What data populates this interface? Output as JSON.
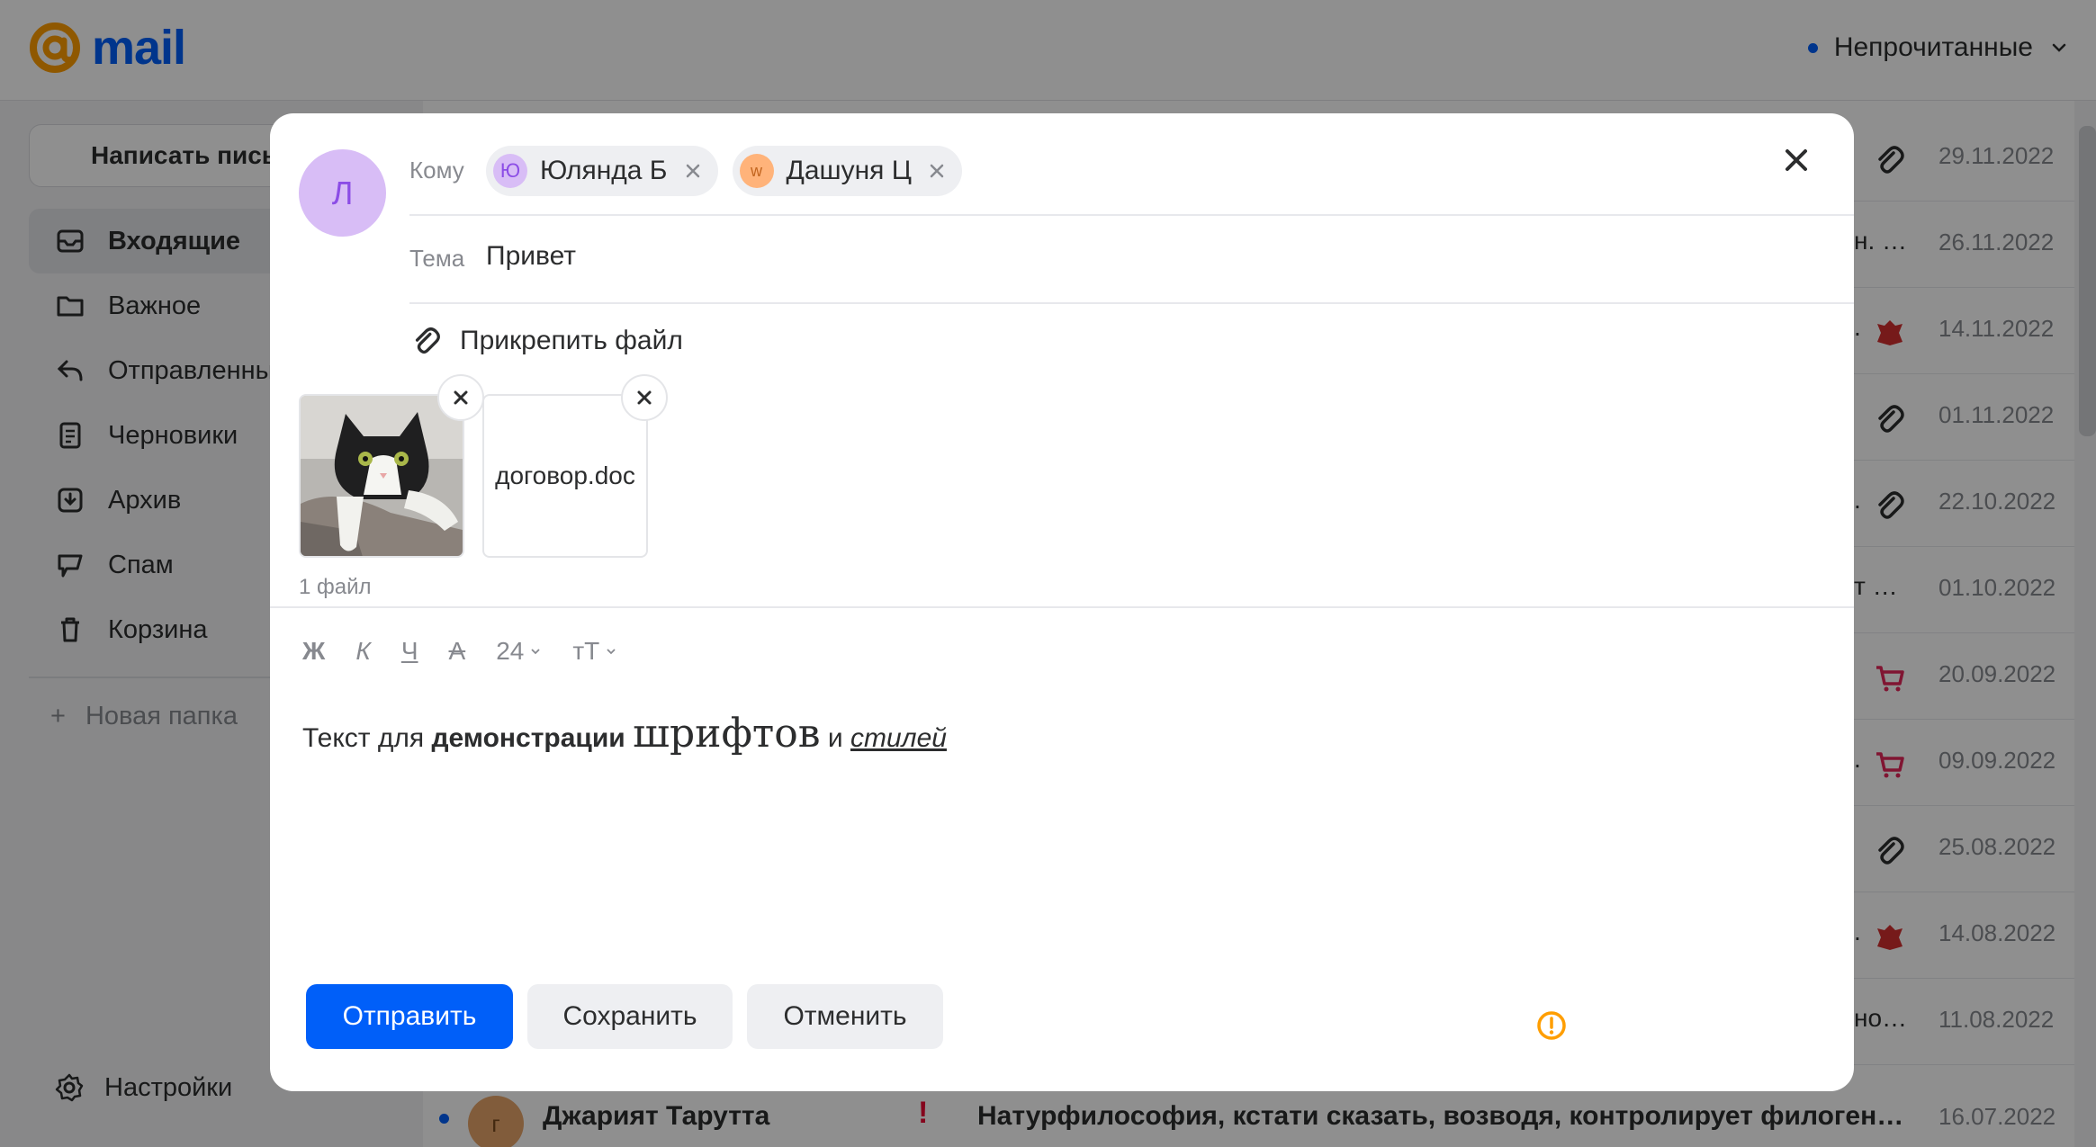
{
  "brand": {
    "logo_text": "mail",
    "brand_color": "#005ff9"
  },
  "header": {
    "filter_label": "Непрочитанные"
  },
  "sidebar": {
    "compose_label": "Написать письмо",
    "items": [
      {
        "label": "Входящие",
        "icon": "inbox-icon",
        "active": true
      },
      {
        "label": "Важное",
        "icon": "folder-icon"
      },
      {
        "label": "Отправленные",
        "icon": "sent-icon"
      },
      {
        "label": "Черновики",
        "icon": "drafts-icon"
      },
      {
        "label": "Архив",
        "icon": "archive-icon"
      },
      {
        "label": "Спам",
        "icon": "spam-icon"
      },
      {
        "label": "Корзина",
        "icon": "trash-icon"
      }
    ],
    "new_folder": "Новая папка",
    "settings": "Настройки"
  },
  "mail_list": {
    "rows": [
      {
        "fragment": "",
        "icon": "paperclip-icon",
        "date": "29.11.2022"
      },
      {
        "fragment": "н. …",
        "icon": "",
        "date": "26.11.2022"
      },
      {
        "fragment": ".",
        "icon": "emblem-icon",
        "date": "14.11.2022"
      },
      {
        "fragment": "",
        "icon": "paperclip-icon",
        "date": "01.11.2022"
      },
      {
        "fragment": ".",
        "icon": "paperclip-icon",
        "date": "22.10.2022"
      },
      {
        "fragment": "т …",
        "icon": "",
        "date": "01.10.2022"
      },
      {
        "fragment": "",
        "icon": "cart-icon",
        "date": "20.09.2022"
      },
      {
        "fragment": ".",
        "icon": "cart-icon",
        "date": "09.09.2022"
      },
      {
        "fragment": "",
        "icon": "paperclip-icon",
        "date": "25.08.2022"
      },
      {
        "fragment": ".",
        "icon": "emblem-icon",
        "date": "14.08.2022"
      },
      {
        "fragment": "но…",
        "icon": "",
        "date": "11.08.2022"
      }
    ],
    "last_row": {
      "avatar_letter": "г",
      "sender": "Джарият Тарутта",
      "flag": "!",
      "subject": "Натурфилософия, кстати сказать, возводя, контролирует филоген…",
      "date": "16.07.2022"
    }
  },
  "compose": {
    "sender_initial": "Л",
    "to_label": "Кому",
    "recipients": [
      {
        "initial": "Ю",
        "name": "Юлянда Б",
        "avatar_bg": "#d8bdf6",
        "avatar_fg": "#8c4de6"
      },
      {
        "initial": "w",
        "name": "Дашуня Ц",
        "avatar_bg": "#ffb37a",
        "avatar_fg": "#c2651f"
      }
    ],
    "subject_label": "Тема",
    "subject_value": "Привет",
    "attach_label": "Прикрепить файл",
    "attachments": [
      {
        "type": "image",
        "name": "cat-photo"
      },
      {
        "type": "doc",
        "name": "договор.doc"
      }
    ],
    "file_count": "1 файл",
    "toolbar": {
      "bold": "Ж",
      "italic": "К",
      "underline": "Ч",
      "strike": "А",
      "font_size": "24",
      "font_family": "тТ"
    },
    "body": {
      "part1": "Текст для ",
      "part2": "демонстрации",
      "part3": " ",
      "part4": "шрифтов",
      "part5": " и ",
      "part6": "стилей"
    },
    "buttons": {
      "send": "Отправить",
      "save": "Сохранить",
      "cancel": "Отменить"
    }
  }
}
